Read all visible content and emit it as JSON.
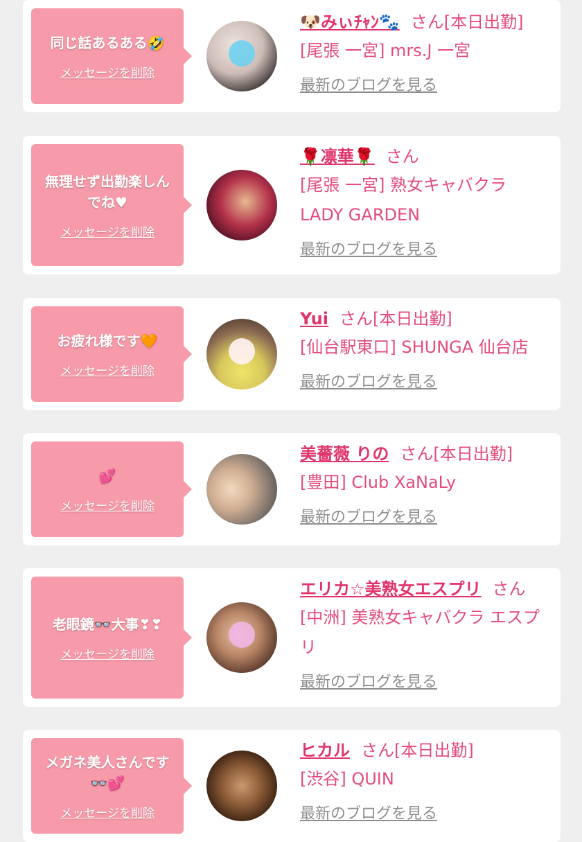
{
  "delete_label": "メッセージを削除",
  "blog_label": "最新のブログを見る",
  "san_suffix": "さん",
  "colors": {
    "background": "#efefef",
    "card": "#ffffff",
    "bubble": "#f79aa9",
    "name": "#e0356a",
    "shop": "#e44c7b",
    "blog_link": "#8e8e8e"
  },
  "cards": [
    {
      "message": "同じ話あるある🤣",
      "name": "🐶みぃﾁｬﾝ🐾",
      "status": "[本日出勤]",
      "shop": "[尾張 一宮] mrs.J 一宮",
      "avatar_icon": "blurred-photo-with-heart-sticker"
    },
    {
      "message": "無理せず出勤楽しんでね♥",
      "name": "🌹凛華🌹",
      "status": "",
      "shop": "[尾張 一宮] 熟女キャバクラ LADY GARDEN",
      "avatar_icon": "photo"
    },
    {
      "message": "お疲れ様です🧡",
      "name": "Yui",
      "status": "[本日出勤]",
      "shop": "[仙台駅東口] SHUNGA 仙台店",
      "avatar_icon": "photo-with-bunny-sticker"
    },
    {
      "message": "💕",
      "name": "美薔薇 りの",
      "status": "[本日出勤]",
      "shop": "[豊田] Club XaNaLy",
      "avatar_icon": "photo"
    },
    {
      "message": "老眼鏡👓大事❣❣",
      "name": "エリカ☆美熟女エスプリ",
      "status": "",
      "shop": "[中洲] 美熟女キャバクラ エスプリ",
      "avatar_icon": "photo-with-sticker"
    },
    {
      "message": "メガネ美人さんです👓💕",
      "name": "ヒカル",
      "status": "[本日出勤]",
      "shop": "[渋谷] QUIN",
      "avatar_icon": "plush-toy-photo"
    }
  ]
}
